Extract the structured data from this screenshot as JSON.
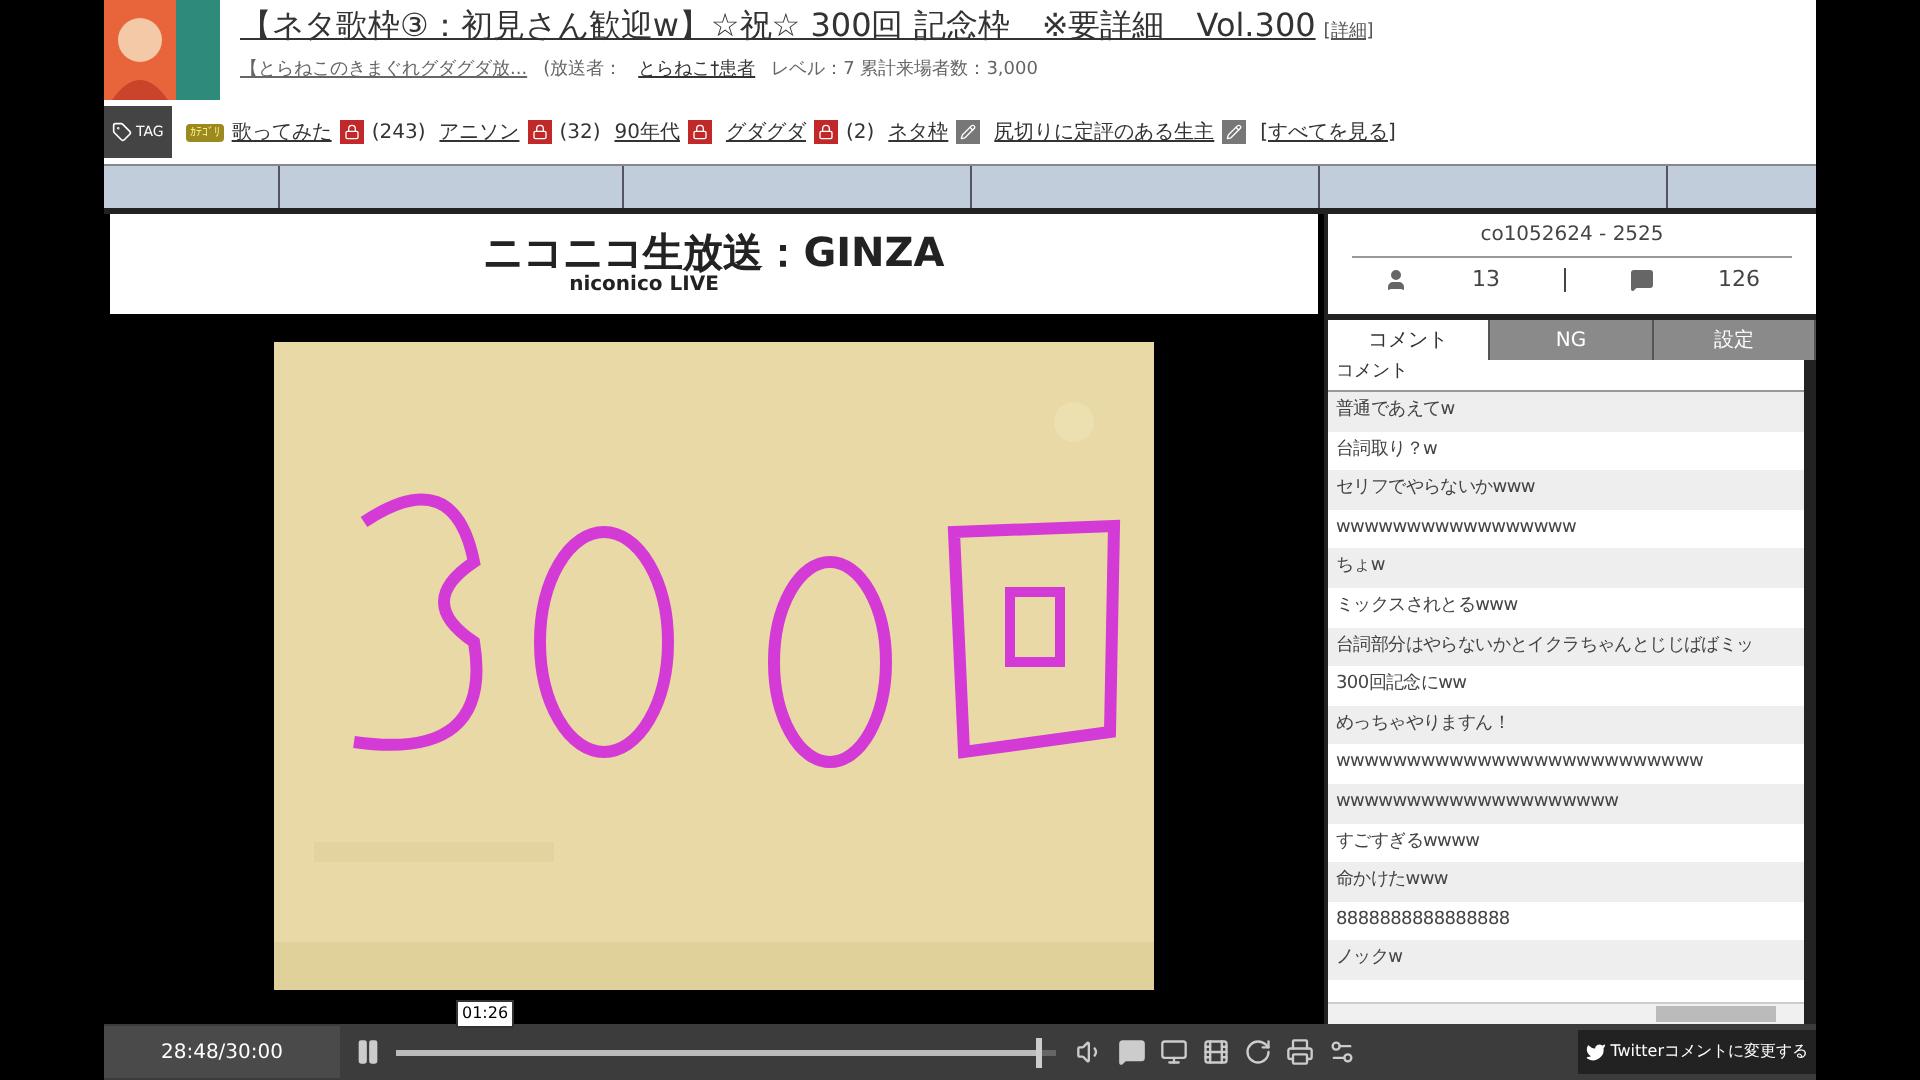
{
  "header": {
    "title": "【ネタ歌枠③：初見さん歓迎w】☆祝☆ 300回 記念枠　※要詳細　Vol.300",
    "detail_link": "[詳細]",
    "community_link": "【とらねこのきまぐれグダグダ放...",
    "broadcaster_label": "(放送者：",
    "broadcaster_link": "とらねこ†患者",
    "stats": "レベル：7 累計来場者数：3,000"
  },
  "tags": {
    "badge": "TAG",
    "items": [
      {
        "label": "歌ってみた",
        "category": "ｶﾃｺﾞﾘ",
        "locked": true,
        "count": "(243)"
      },
      {
        "label": "アニソン",
        "locked": true,
        "count": "(32)"
      },
      {
        "label": "90年代",
        "locked": true
      },
      {
        "label": "グダグダ",
        "locked": true,
        "count": "(2)"
      },
      {
        "label": "ネタ枠",
        "locked": false
      },
      {
        "label": "尻切りに定評のある生主",
        "locked": false
      }
    ],
    "see_all": "[すべてを見る]"
  },
  "logo": {
    "title": "ニコニコ生放送：GINZA",
    "subtitle": "niconico LIVE"
  },
  "info": {
    "id": "co1052624 - 2525",
    "viewers": "13",
    "comments": "126"
  },
  "tabs": [
    {
      "label": "コメント",
      "selected": true
    },
    {
      "label": "NG",
      "selected": false
    },
    {
      "label": "設定",
      "selected": false
    }
  ],
  "comment_header": "コメント",
  "comments": [
    "普通であえてw",
    "台詞取り？w",
    "セリフでやらないかwww",
    "wwwwwwwwwwwwwwwww",
    "ちょw",
    "ミックスされとるwww",
    "台詞部分はやらないかとイクラちゃんとじじばばミッ",
    "300回記念にww",
    "めっちゃやりますん！",
    "wwwwwwwwwwwwwwwwwwwwwwwwww",
    "wwwwwwwwwwwwwwwwwwww",
    "すごすぎるwwww",
    "命かけたwww",
    "8888888888888888",
    "ノックw"
  ],
  "player": {
    "time": "28:48/30:00",
    "tooltip": "01:26",
    "seek": {
      "level": 0.97
    },
    "twitter_button": "Twitterコメントに変更する"
  }
}
